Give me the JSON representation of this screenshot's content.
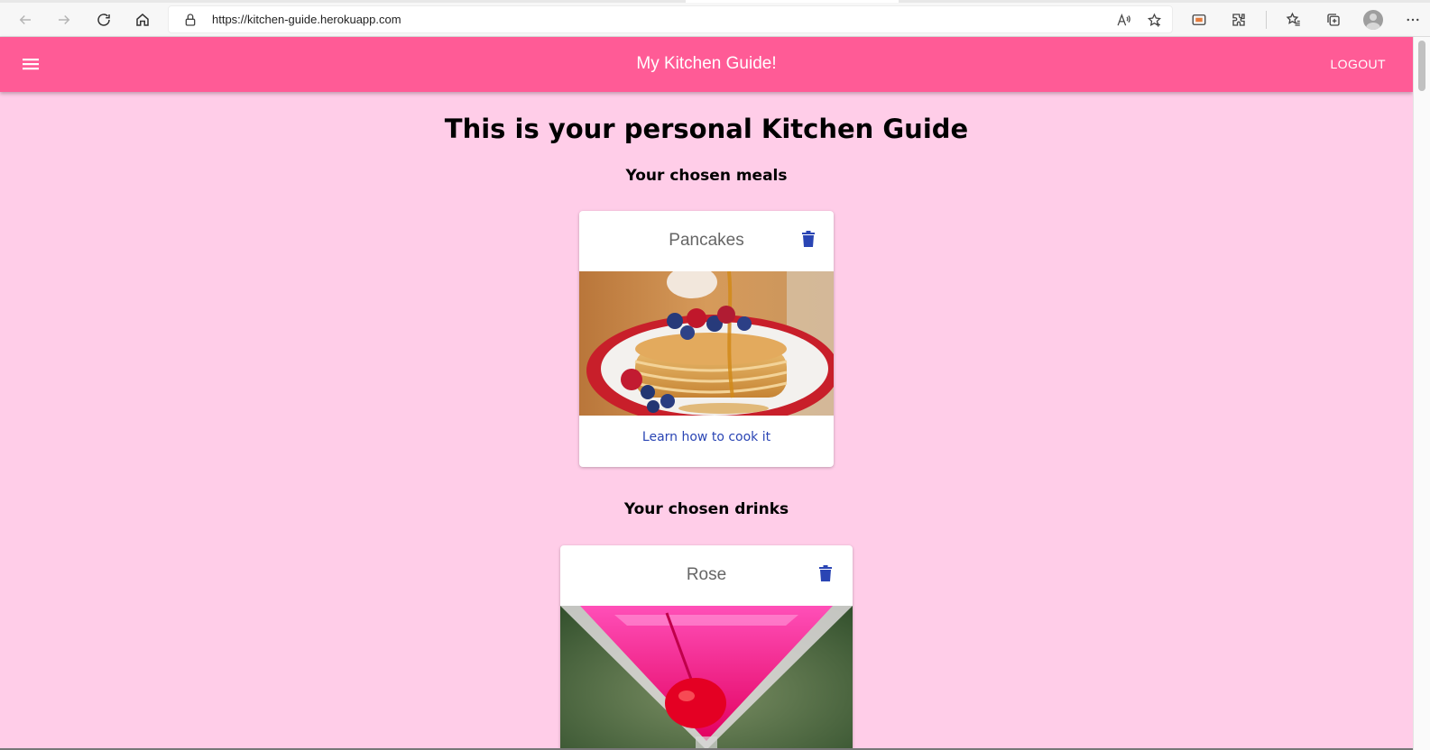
{
  "browser": {
    "url": "https://kitchen-guide.herokuapp.com"
  },
  "appbar": {
    "title": "My Kitchen Guide!",
    "logout_label": "LOGOUT",
    "color": "#ff5b96"
  },
  "page": {
    "heading": "This is your personal Kitchen Guide",
    "meals_heading": "Your chosen meals",
    "drinks_heading": "Your chosen drinks",
    "background": "#ffcde8"
  },
  "meals": [
    {
      "title": "Pancakes",
      "link_label": "Learn how to cook it",
      "icon": "trash-icon"
    }
  ],
  "drinks": [
    {
      "title": "Rose",
      "icon": "trash-icon"
    }
  ],
  "colors": {
    "link": "#2a45b4",
    "delete_icon": "#2a45b4"
  }
}
